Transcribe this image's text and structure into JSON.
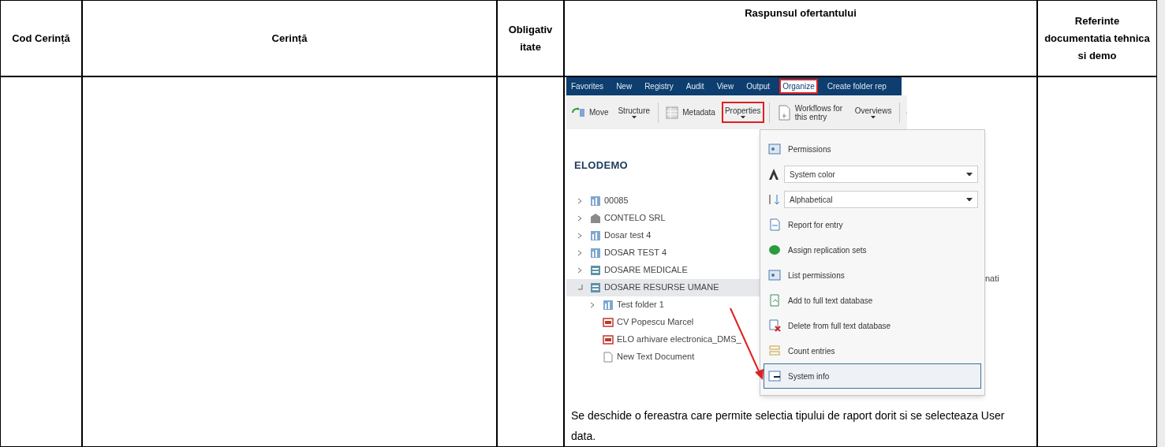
{
  "table": {
    "columns": [
      "Cod Cerință",
      "Cerință",
      "Obligativ itate",
      "Raspunsul ofertantului",
      "Referinte documentatia tehnica si demo"
    ],
    "response": {
      "screenshot": {
        "ribbon_tabs": [
          {
            "label": "Favorites",
            "highlighted": false
          },
          {
            "label": "New",
            "highlighted": false
          },
          {
            "label": "Registry",
            "highlighted": false
          },
          {
            "label": "Audit",
            "highlighted": false
          },
          {
            "label": "View",
            "highlighted": false
          },
          {
            "label": "Output",
            "highlighted": false
          },
          {
            "label": "Organize",
            "highlighted": true
          },
          {
            "label": "Create folder rep",
            "highlighted": false
          }
        ],
        "toolbar": [
          {
            "kind": "button",
            "label": "Move",
            "highlighted": false
          },
          {
            "kind": "dropdown",
            "label": "Structure",
            "highlighted": false
          },
          {
            "kind": "separator"
          },
          {
            "kind": "button",
            "label": "Metadata",
            "highlighted": false
          },
          {
            "kind": "dropdown",
            "label": "Properties",
            "highlighted": true
          },
          {
            "kind": "separator"
          },
          {
            "kind": "button",
            "label": "Workflows for this entry",
            "highlighted": false
          },
          {
            "kind": "dropdown",
            "label": "Overviews",
            "highlighted": false
          },
          {
            "kind": "separator"
          },
          {
            "kind": "close"
          }
        ],
        "tree": {
          "title": "ELODEMO",
          "items": [
            {
              "kind": "folder",
              "label": "00085",
              "expanded": false,
              "selected": false
            },
            {
              "kind": "company",
              "label": "CONTELO SRL",
              "expanded": false,
              "selected": false
            },
            {
              "kind": "folder",
              "label": "Dosar test 4",
              "expanded": false,
              "selected": false
            },
            {
              "kind": "folder",
              "label": "DOSAR TEST 4",
              "expanded": false,
              "selected": false
            },
            {
              "kind": "cabinet",
              "label": "DOSARE MEDICALE",
              "expanded": false,
              "selected": false
            },
            {
              "kind": "cabinet",
              "label": "DOSARE RESURSE UMANE",
              "expanded": true,
              "selected": true,
              "children": [
                {
                  "kind": "folder",
                  "label": "Test folder 1",
                  "expanded": false,
                  "selected": false
                },
                {
                  "kind": "pdf",
                  "label": "CV Popescu Marcel",
                  "selected": false
                },
                {
                  "kind": "pdf",
                  "label": "ELO arhivare electronica_DMS_",
                  "selected": false
                },
                {
                  "kind": "text",
                  "label": "New Text Document",
                  "selected": false
                }
              ]
            }
          ]
        },
        "background_text": "nati",
        "menu": [
          {
            "kind": "item",
            "label": "Permissions",
            "selected": false
          },
          {
            "kind": "dropdown",
            "label": "System color",
            "selected": false
          },
          {
            "kind": "dropdown",
            "label": "Alphabetical",
            "selected": false
          },
          {
            "kind": "item",
            "label": "Report for entry",
            "selected": false
          },
          {
            "kind": "item",
            "label": "Assign replication sets",
            "selected": false
          },
          {
            "kind": "item",
            "label": "List permissions",
            "selected": false
          },
          {
            "kind": "item",
            "label": "Add to full text database",
            "selected": false
          },
          {
            "kind": "item",
            "label": "Delete from full text database",
            "selected": false
          },
          {
            "kind": "item",
            "label": "Count entries",
            "selected": false
          },
          {
            "kind": "item",
            "label": "System info",
            "selected": true
          }
        ]
      },
      "text": "Se deschide o fereastra care permite selectia tipului de raport dorit si se selecteaza User data."
    }
  }
}
